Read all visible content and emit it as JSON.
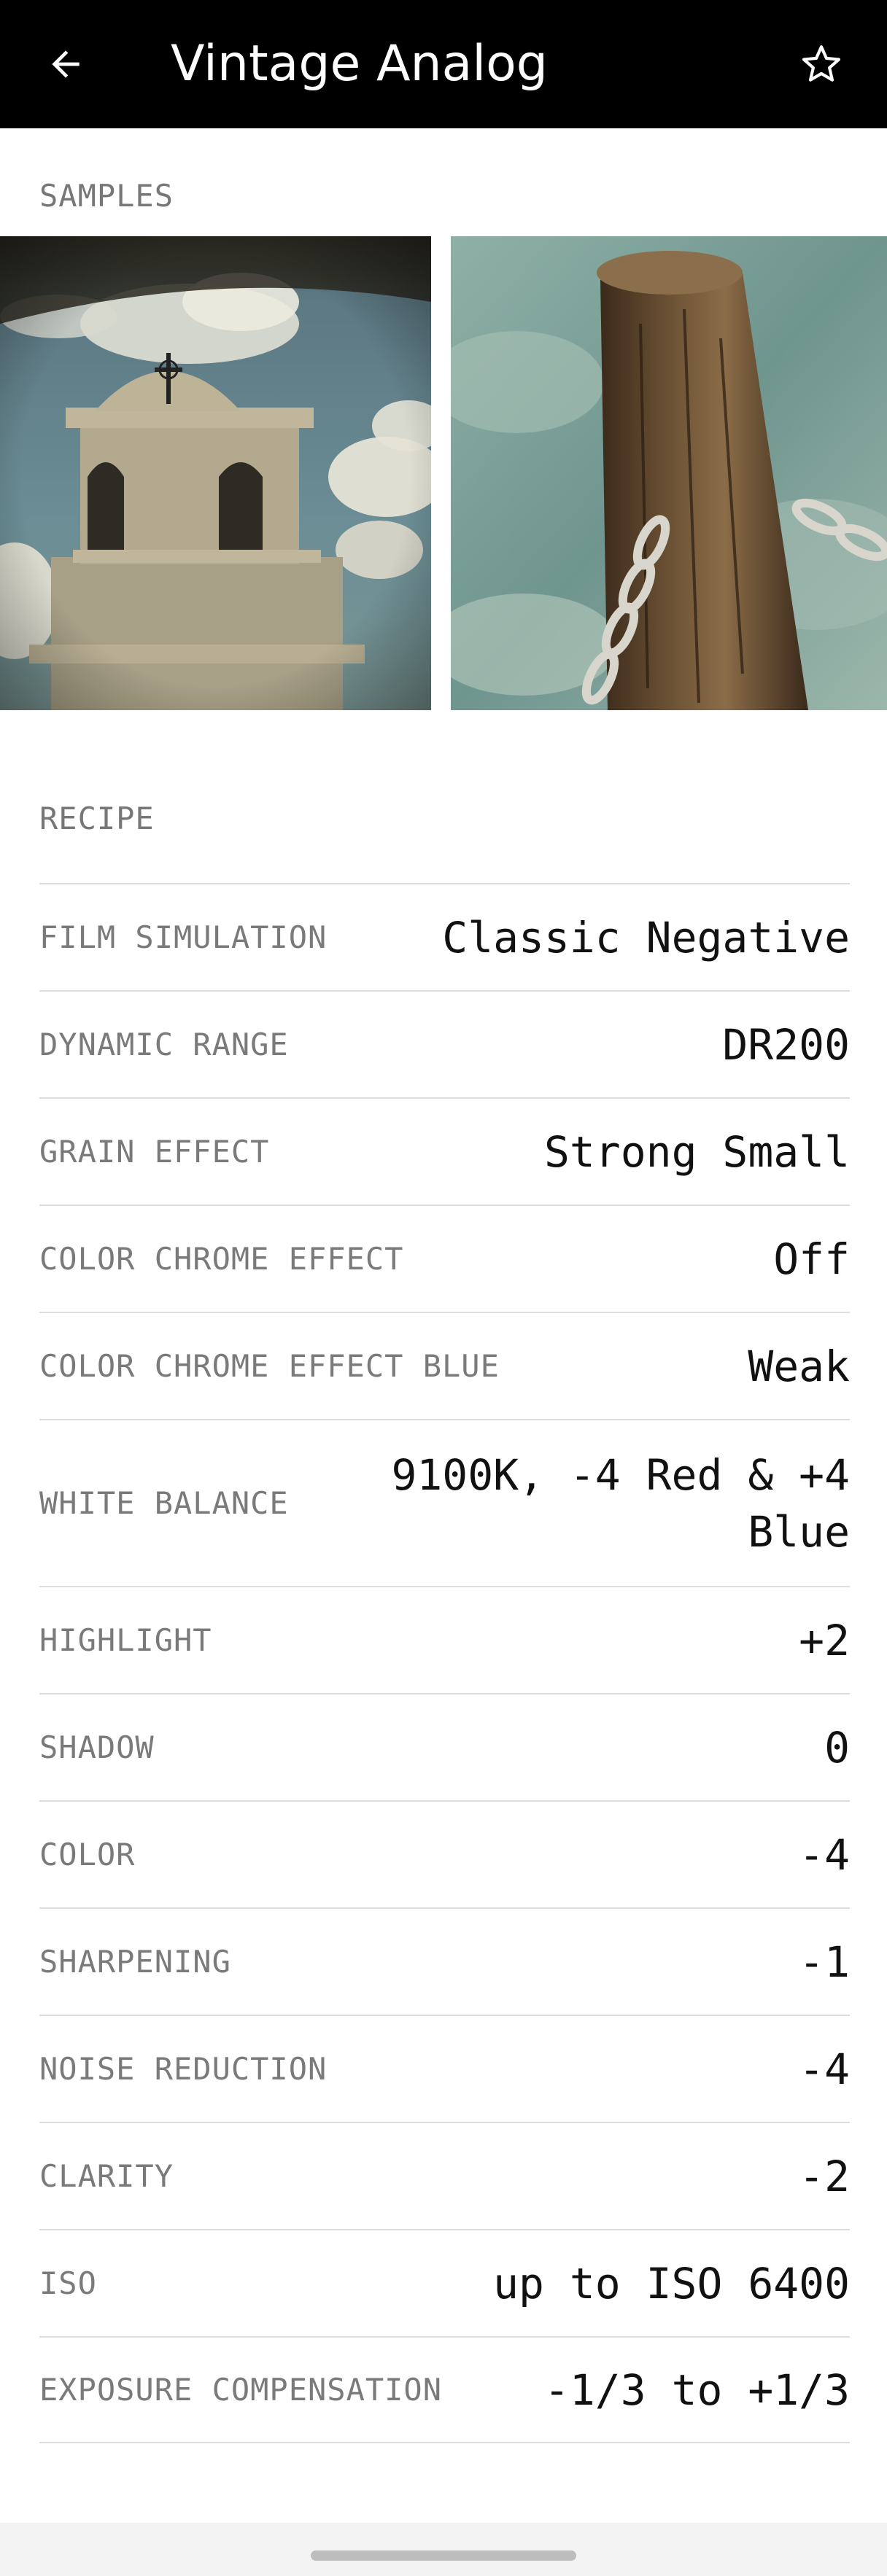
{
  "appbar": {
    "title": "Vintage Analog",
    "back_icon": "arrow-left-icon",
    "favorite_icon": "star-outline-icon"
  },
  "samples": {
    "label": "SAMPLES",
    "images": [
      {
        "name": "bell-tower-photo",
        "description_icon": "image"
      },
      {
        "name": "wooden-post-chain-photo",
        "description_icon": "image"
      }
    ]
  },
  "recipe": {
    "label": "RECIPE",
    "rows": [
      {
        "key": "FILM SIMULATION",
        "value": "Classic Negative"
      },
      {
        "key": "DYNAMIC RANGE",
        "value": "DR200"
      },
      {
        "key": "GRAIN EFFECT",
        "value": "Strong Small"
      },
      {
        "key": "COLOR CHROME EFFECT",
        "value": "Off"
      },
      {
        "key": "COLOR CHROME EFFECT BLUE",
        "value": "Weak"
      },
      {
        "key": "WHITE BALANCE",
        "value": "9100K, -4 Red & +4 Blue"
      },
      {
        "key": "HIGHLIGHT",
        "value": "+2"
      },
      {
        "key": "SHADOW",
        "value": "0"
      },
      {
        "key": "COLOR",
        "value": "-4"
      },
      {
        "key": "SHARPENING",
        "value": "-1"
      },
      {
        "key": "NOISE REDUCTION",
        "value": "-4"
      },
      {
        "key": "CLARITY",
        "value": "-2"
      },
      {
        "key": "ISO",
        "value": "up to ISO 6400"
      },
      {
        "key": "EXPOSURE COMPENSATION",
        "value": "-1/3 to +1/3"
      }
    ]
  }
}
